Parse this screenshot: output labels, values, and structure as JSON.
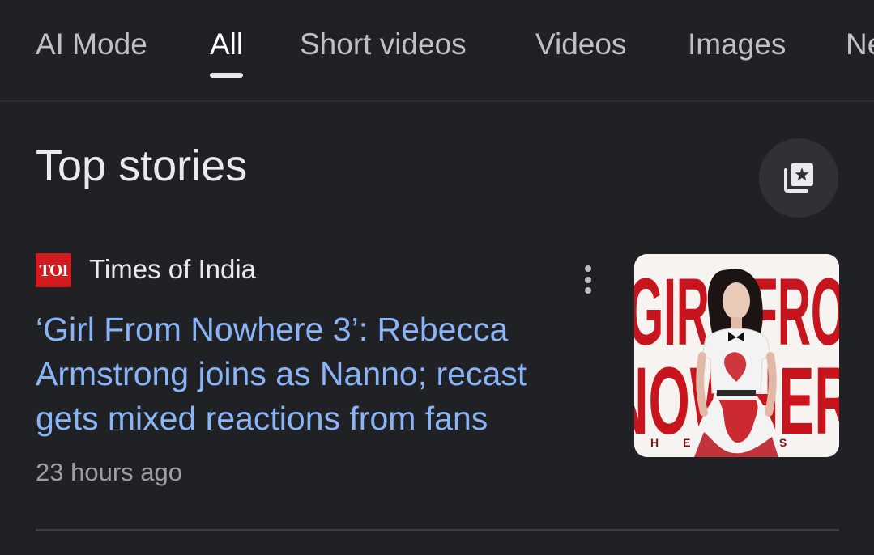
{
  "tabs": [
    {
      "label": "AI Mode",
      "active": false
    },
    {
      "label": "All",
      "active": true
    },
    {
      "label": "Short videos",
      "active": false
    },
    {
      "label": "Videos",
      "active": false
    },
    {
      "label": "Images",
      "active": false
    },
    {
      "label": "News",
      "active": false
    }
  ],
  "top_stories": {
    "title": "Top stories",
    "save_icon": "collections-star-icon",
    "story": {
      "publisher_logo_text": "TOI",
      "publisher": "Times of India",
      "headline": "‘Girl From Nowhere 3’: Rebecca Armstrong joins as Nanno; recast gets mixed reactions from fans",
      "time": "23 hours ago",
      "more_icon": "more-vertical-icon",
      "thumbnail": {
        "big_text_top": "GIRL FRO",
        "big_text_bottom": "NOWHER",
        "small_text": "HERES",
        "colors": {
          "red": "#c8141c",
          "white": "#f6f3f1",
          "hair": "#1b1412"
        }
      }
    }
  },
  "colors": {
    "background": "#202124",
    "link": "#8ab4f8",
    "muted": "#9aa0a6"
  }
}
